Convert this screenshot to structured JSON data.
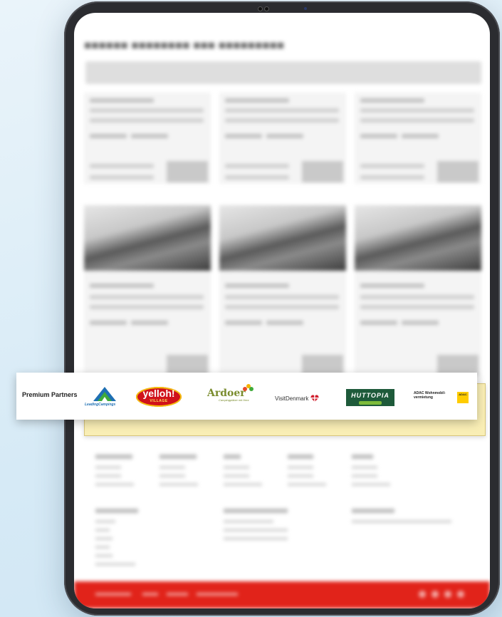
{
  "partner_bar": {
    "label": "Premium Partners",
    "logos": {
      "leading_campings": "LeadingCampings",
      "yelloh_main": "yelloh!",
      "yelloh_sub": "VILLAGE",
      "ardoer_main": "Ardoer",
      "ardoer_tagline": "Campingplätze mit Herz",
      "visit_denmark": "VisitDenmark",
      "huttopia": "HUTTOPIA",
      "adac": "ADAC Wohnmobil-vermietung",
      "adac_badge": "ADAC"
    }
  },
  "colors": {
    "footer_red": "#e1231a",
    "highlight_yellow": "#f9eeb5",
    "huttopia_green": "#1e5a3a",
    "yelloh_red": "#d0121b"
  },
  "icons": [
    "leading-campings-mountain-icon",
    "visit-denmark-heart-icon",
    "ardoer-flower-icon"
  ]
}
